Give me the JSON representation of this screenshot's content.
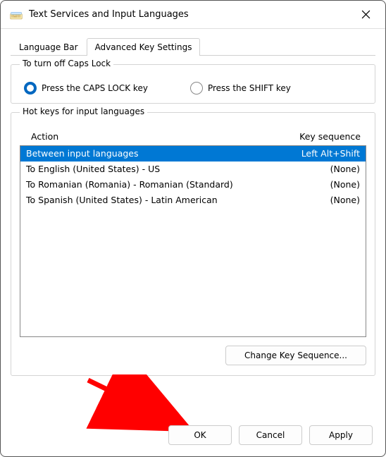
{
  "titlebar": {
    "title": "Text Services and Input Languages"
  },
  "tabs": [
    {
      "label": "Language Bar",
      "active": false
    },
    {
      "label": "Advanced Key Settings",
      "active": true
    }
  ],
  "caps_group": {
    "legend": "To turn off Caps Lock",
    "opt1": "Press the CAPS LOCK key",
    "opt2": "Press the SHIFT key"
  },
  "hotkeys_group": {
    "legend": "Hot keys for input languages",
    "col_action": "Action",
    "col_keyseq": "Key sequence",
    "rows": [
      {
        "action": "Between input languages",
        "keyseq": "Left Alt+Shift",
        "selected": true
      },
      {
        "action": "To English (United States) - US",
        "keyseq": "(None)",
        "selected": false
      },
      {
        "action": "To Romanian (Romania) - Romanian (Standard)",
        "keyseq": "(None)",
        "selected": false
      },
      {
        "action": "To Spanish (United States) - Latin American",
        "keyseq": "(None)",
        "selected": false
      }
    ],
    "change_btn": "Change Key Sequence..."
  },
  "buttons": {
    "ok": "OK",
    "cancel": "Cancel",
    "apply": "Apply"
  }
}
